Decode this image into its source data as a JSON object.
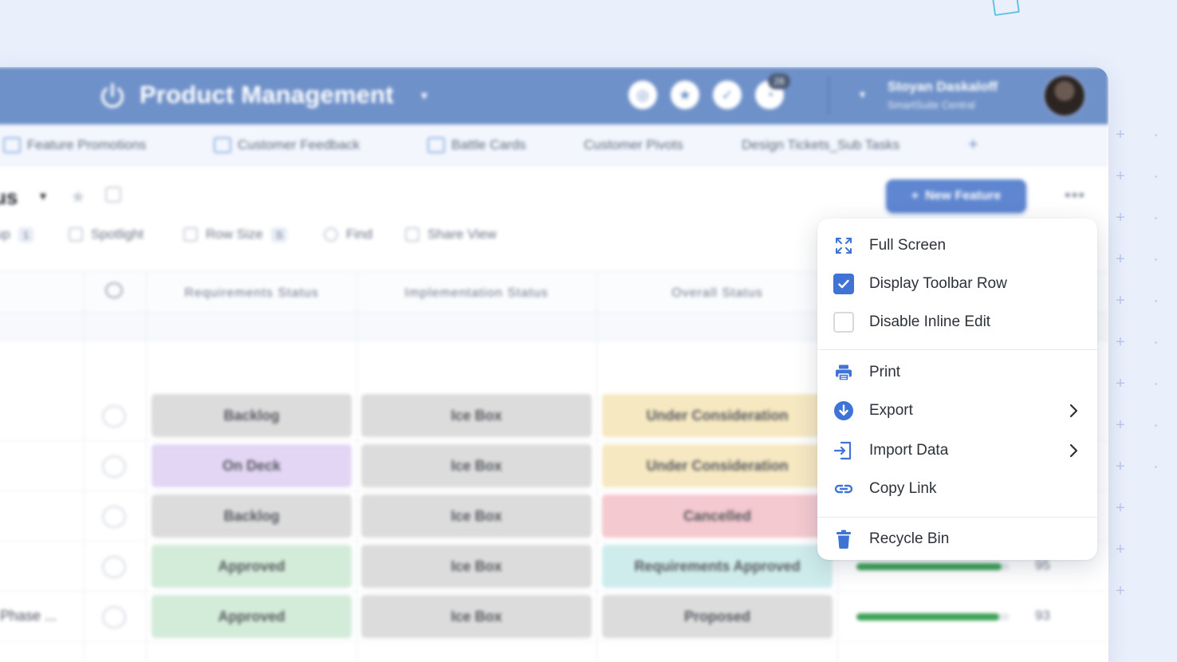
{
  "header": {
    "title": "Product Management",
    "badge_count": "28",
    "user_name": "Stoyan Daskaloff",
    "user_org": "SmartSuite Central"
  },
  "tabs": [
    {
      "label": "Feature Promotions"
    },
    {
      "label": "Customer Feedback"
    },
    {
      "label": "Battle Cards"
    },
    {
      "label": "Customer Pivots"
    },
    {
      "label": "Design Tickets_Sub Tasks"
    }
  ],
  "toolbar": {
    "view_title": "us",
    "new_button": "New Feature",
    "group_label": "up",
    "group_count": "1",
    "spotlight": "Spotlight",
    "row_size": "Row Size",
    "row_size_value": "S",
    "find": "Find",
    "share_view": "Share View"
  },
  "grid": {
    "columns": [
      "Requirements Status",
      "Implementation Status",
      "Overall Status"
    ],
    "rows": [
      {
        "name": "",
        "req": "Backlog",
        "impl": "Ice Box",
        "overall": "Under Consideration",
        "req_color": "#dcdcdc",
        "impl_color": "#dcdcdc",
        "overall_color": "#f6e8c1",
        "progress": null,
        "progress_label": ""
      },
      {
        "name": "",
        "req": "On Deck",
        "impl": "Ice Box",
        "overall": "Under Consideration",
        "req_color": "#e3d6f5",
        "impl_color": "#dcdcdc",
        "overall_color": "#f6e8c1",
        "progress": null,
        "progress_label": ""
      },
      {
        "name": "",
        "req": "Backlog",
        "impl": "Ice Box",
        "overall": "Cancelled",
        "req_color": "#dcdcdc",
        "impl_color": "#dcdcdc",
        "overall_color": "#f4c9cf",
        "progress": null,
        "progress_label": ""
      },
      {
        "name": "",
        "req": "Approved",
        "impl": "Ice Box",
        "overall": "Requirements Approved",
        "req_color": "#d3ecd9",
        "impl_color": "#dcdcdc",
        "overall_color": "#cfecec",
        "progress": 0.95,
        "progress_label": "95"
      },
      {
        "name": "Phase ...",
        "req": "Approved",
        "impl": "Ice Box",
        "overall": "Proposed",
        "req_color": "#d3ecd9",
        "impl_color": "#dcdcdc",
        "overall_color": "#dcdcdc",
        "progress": 0.93,
        "progress_label": "93"
      }
    ]
  },
  "menu": {
    "full_screen": "Full Screen",
    "display_toolbar_row": "Display Toolbar Row",
    "display_toolbar_row_checked": true,
    "disable_inline_edit": "Disable Inline Edit",
    "disable_inline_edit_checked": false,
    "print": "Print",
    "export": "Export",
    "import_data": "Import Data",
    "copy_link": "Copy Link",
    "recycle_bin": "Recycle Bin"
  },
  "colors": {
    "accent": "#3f73d6",
    "header": "#6f91c9",
    "background": "#e9effb"
  }
}
